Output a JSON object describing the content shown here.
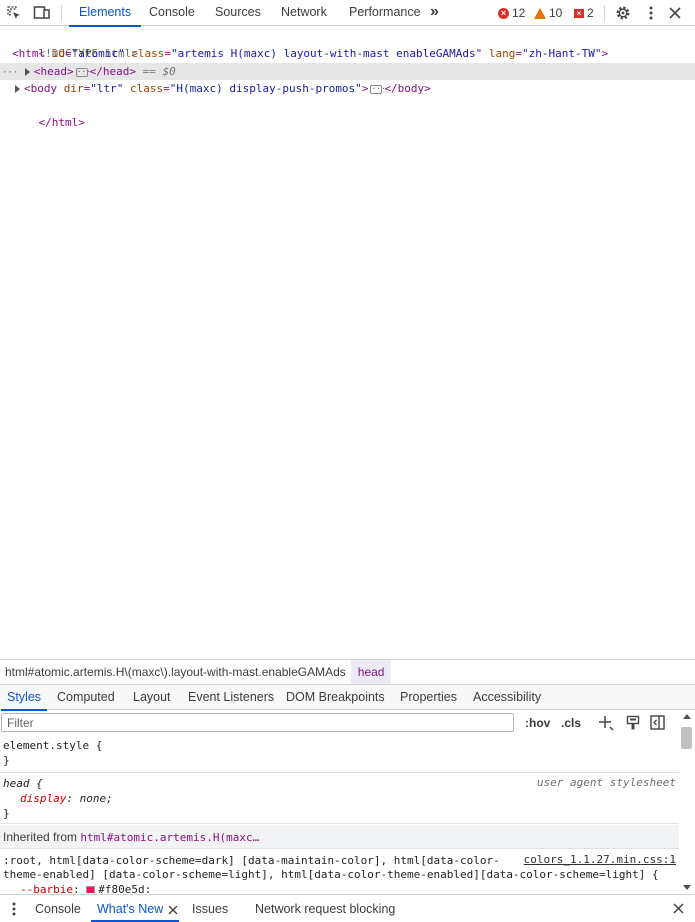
{
  "toolbar": {
    "tabs": [
      "Elements",
      "Console",
      "Sources",
      "Network",
      "Performance"
    ],
    "more_tabs": "»",
    "errors": "12",
    "warnings": "10",
    "issues": "2"
  },
  "dom": {
    "doctype": "<!DOCTYPE html>",
    "html_open": {
      "tag_open": "<html",
      "id_name": "id",
      "id_val": "\"atomic\"",
      "class_name": "class",
      "class_val": "\"artemis H(maxc) layout-with-mast enableGAMAds\"",
      "lang_name": "lang",
      "lang_val": "\"zh-Hant-TW\"",
      "tag_close": ">"
    },
    "head": {
      "open": "<head>",
      "close": "</head>",
      "selected_marker": "== $0",
      "dots": "···"
    },
    "body": {
      "tag_open": "<body",
      "dir_name": "dir",
      "dir_val": "\"ltr\"",
      "class_name": "class",
      "class_val": "\"H(maxc) display-push-promos\"",
      "tag_close": ">",
      "close": "</body>"
    },
    "html_close": "</html>"
  },
  "breadcrumb": {
    "items": [
      "html#atomic.artemis.H\\(maxc\\).layout-with-mast.enableGAMAds",
      "head"
    ]
  },
  "styles_tabs": [
    "Styles",
    "Computed",
    "Layout",
    "Event Listeners",
    "DOM Breakpoints",
    "Properties",
    "Accessibility"
  ],
  "filter": {
    "placeholder": "Filter",
    "hov": ":hov",
    "cls": ".cls"
  },
  "rules": {
    "element_style": {
      "selector": "element.style {",
      "close": "}"
    },
    "head_rule": {
      "selector": "head {",
      "source": "user agent stylesheet",
      "prop": "display",
      "value": "none;",
      "close": "}"
    },
    "inherited": {
      "label": "Inherited from",
      "link": "html#atomic.artemis.H(maxc…"
    },
    "root_rule": {
      "selector_line1": ":root, html[data-color-scheme=dark] [data-maintain-color], html[data-color-",
      "selector_line2": "theme-enabled] [data-color-scheme=light], html[data-color-theme-enabled][data-color-scheme=light] {",
      "source": "colors_1.1.27.min.css:1",
      "prop": "--barbie",
      "value": "#f80e5d;",
      "swatch_color": "#f80e5d"
    }
  },
  "drawer": {
    "tabs": [
      "Console",
      "What's New",
      "Issues",
      "Network request blocking"
    ]
  },
  "colors": {
    "accent": "#0b57d0",
    "error": "#d93025",
    "warning": "#e37400"
  }
}
